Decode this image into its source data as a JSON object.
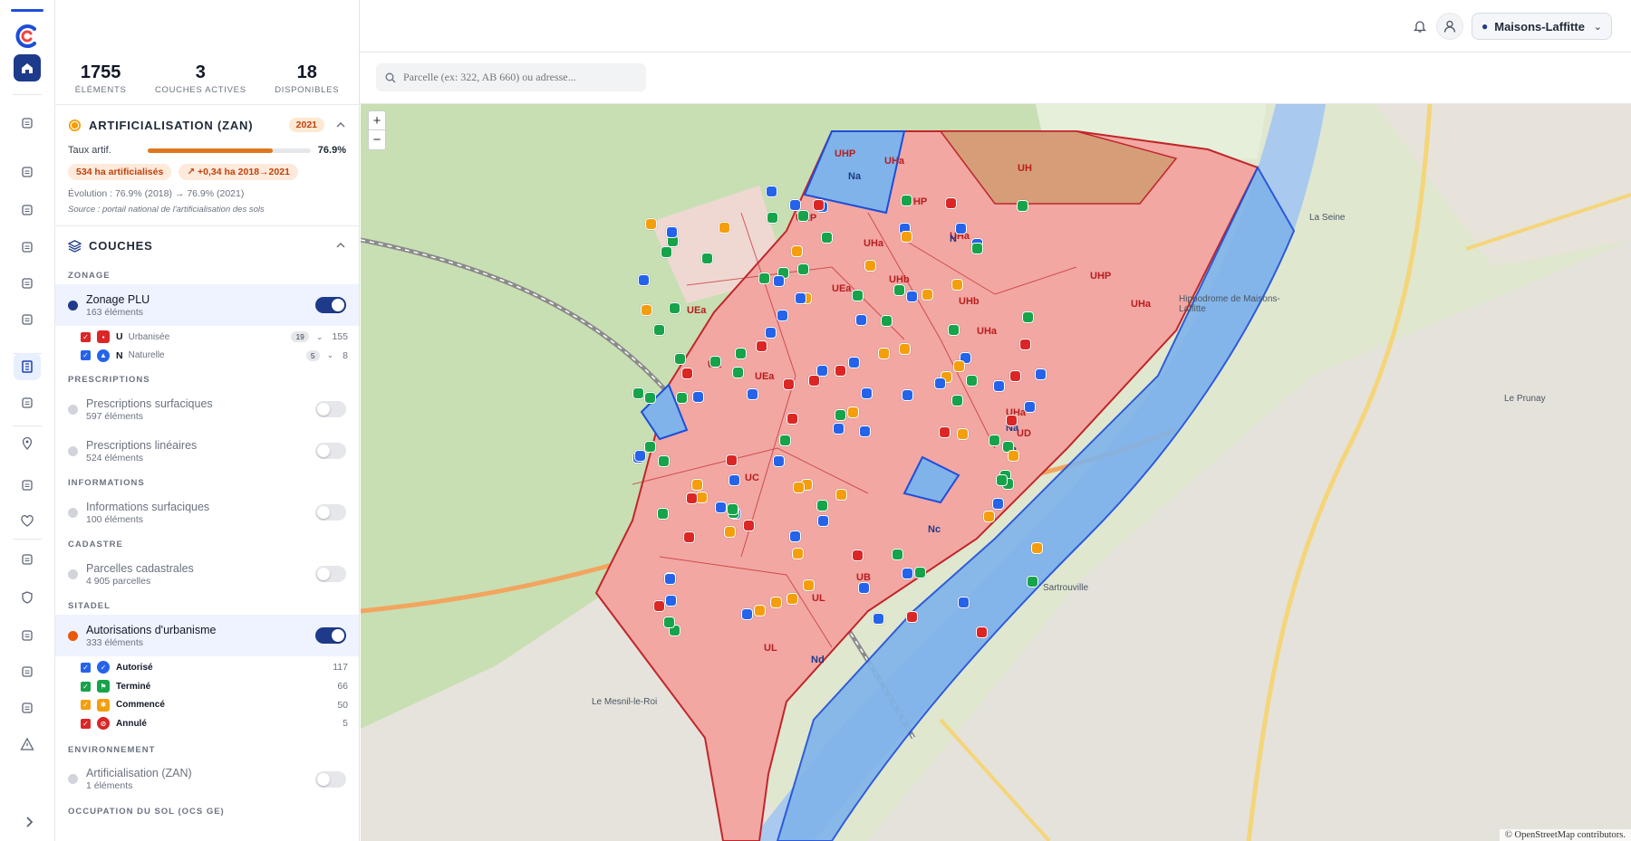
{
  "app": {
    "logo_icon": "app-logo-icon",
    "city": "Maisons-Laffitte"
  },
  "rail": {
    "items": [
      {
        "name": "home",
        "icon": "home-icon"
      },
      {
        "name": "documents",
        "icon": "clipboard-icon"
      },
      {
        "name": "wallet",
        "icon": "wallet-icon"
      },
      {
        "name": "tickets",
        "icon": "ticket-icon"
      },
      {
        "name": "calculator",
        "icon": "calculator-icon"
      },
      {
        "name": "files",
        "icon": "file-icon"
      },
      {
        "name": "bank",
        "icon": "bank-icon"
      },
      {
        "name": "urbanism-map",
        "icon": "map-building-icon"
      },
      {
        "name": "transport",
        "icon": "car-icon"
      },
      {
        "name": "places",
        "icon": "pin-icon"
      },
      {
        "name": "population",
        "icon": "people-icon"
      },
      {
        "name": "health",
        "icon": "heart-icon"
      },
      {
        "name": "business",
        "icon": "briefcase-icon"
      },
      {
        "name": "security",
        "icon": "shield-icon"
      },
      {
        "name": "commerce",
        "icon": "shop-icon"
      },
      {
        "name": "buildings",
        "icon": "building-icon"
      },
      {
        "name": "agriculture",
        "icon": "leaf-icon"
      },
      {
        "name": "risks",
        "icon": "warning-icon"
      }
    ],
    "expand_icon": "chevron-right-icon"
  },
  "stats": [
    {
      "value": "1755",
      "label": "ÉLÉMENTS"
    },
    {
      "value": "3",
      "label": "COUCHES ACTIVES"
    },
    {
      "value": "18",
      "label": "DISPONIBLES"
    }
  ],
  "zan": {
    "title": "ARTIFICIALISATION (ZAN)",
    "year": "2021",
    "rate_label": "Taux artif.",
    "rate_value": "76.9%",
    "rate_fraction": 0.769,
    "chip_area": "534 ha artificialisés",
    "chip_delta": "+0,34 ha 2018→2021",
    "evolution": "Évolution : 76.9% (2018) → 76.9% (2021)",
    "source": "Source : portail national de l'artificialisation des sols"
  },
  "layers": {
    "title": "COUCHES",
    "zonage": {
      "group": "ZONAGE",
      "name": "Zonage PLU",
      "count": "163 éléments",
      "enabled": true,
      "subs": [
        {
          "code": "U",
          "label": "Urbanisée",
          "pill": "19",
          "count": "155",
          "color": "#dc2626"
        },
        {
          "code": "N",
          "label": "Naturelle",
          "pill": "5",
          "count": "8",
          "color": "#2563eb"
        }
      ]
    },
    "prescriptions": {
      "group": "PRESCRIPTIONS",
      "items": [
        {
          "name": "Prescriptions surfaciques",
          "count": "597 éléments"
        },
        {
          "name": "Prescriptions linéaires",
          "count": "524 éléments"
        }
      ]
    },
    "informations": {
      "group": "INFORMATIONS",
      "items": [
        {
          "name": "Informations surfaciques",
          "count": "100 éléments"
        }
      ]
    },
    "cadastre": {
      "group": "CADASTRE",
      "items": [
        {
          "name": "Parcelles cadastrales",
          "count": "4 905 parcelles"
        }
      ]
    },
    "sitadel": {
      "group": "SITADEL",
      "name": "Autorisations d'urbanisme",
      "count": "333 éléments",
      "enabled": true,
      "subs": [
        {
          "label": "Autorisé",
          "count": "117",
          "color": "#2563eb"
        },
        {
          "label": "Terminé",
          "count": "66",
          "color": "#16a34a"
        },
        {
          "label": "Commencé",
          "count": "50",
          "color": "#f59e0b"
        },
        {
          "label": "Annulé",
          "count": "5",
          "color": "#dc2626"
        }
      ]
    },
    "environnement": {
      "group": "ENVIRONNEMENT",
      "items": [
        {
          "name": "Artificialisation (ZAN)",
          "count": "1 éléments"
        }
      ]
    },
    "next_group": "OCCUPATION DU SOL (OCS GE)"
  },
  "search": {
    "placeholder": "Parcelle (ex: 322, AB 660) ou adresse..."
  },
  "map": {
    "zoom_in": "+",
    "zoom_out": "−",
    "attribution": "© OpenStreetMap contributors.",
    "labels": {
      "zones_u": [
        "UHP",
        "UHa",
        "UHP",
        "UHa",
        "UEa",
        "UEa",
        "UHP",
        "UHa",
        "UE",
        "UHa",
        "UEa",
        "UHb",
        "UHb",
        "UHP",
        "UHa",
        "UD",
        "UC",
        "UB",
        "UL",
        "UL",
        "UHa",
        "UH"
      ],
      "zones_n": [
        "Na",
        "Na",
        "N",
        "Nc",
        "Nd",
        "Na"
      ]
    },
    "osm_labels": [
      "Sartrouville",
      "La Seine",
      "Hippodrome de Maisons-Laffitte",
      "Le Prunay",
      "Le Mesnil-le-Roi"
    ]
  }
}
